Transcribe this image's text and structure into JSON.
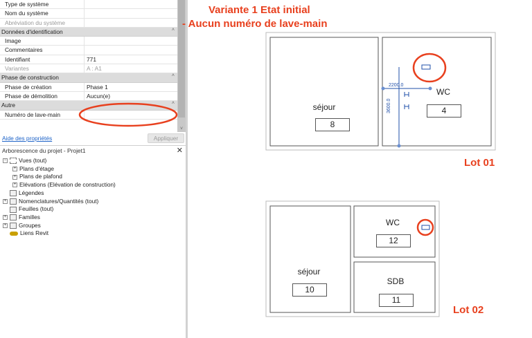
{
  "properties": {
    "rows_top": [
      {
        "key": "Type de système",
        "value": ""
      },
      {
        "key": "Nom du système",
        "value": ""
      },
      {
        "key": "Abréviation du système",
        "value": "",
        "grey": true
      }
    ],
    "groups": [
      {
        "title": "Données d'identification",
        "rows": [
          {
            "key": "Image",
            "value": ""
          },
          {
            "key": "Commentaires",
            "value": ""
          },
          {
            "key": "Identifiant",
            "value": "771"
          },
          {
            "key": "Variantes",
            "value": "A : A1",
            "grey": true
          }
        ]
      },
      {
        "title": "Phase de construction",
        "rows": [
          {
            "key": "Phase de création",
            "value": "Phase 1"
          },
          {
            "key": "Phase de démolition",
            "value": "Aucun(e)"
          }
        ]
      },
      {
        "title": "Autre",
        "rows": [
          {
            "key": "Numéro de lave-main",
            "value": ""
          }
        ]
      }
    ],
    "help_link": "Aide des propriétés",
    "apply_button": "Appliquer"
  },
  "browser": {
    "title": "Arborescence du projet - Projet1",
    "items": [
      {
        "label": "Vues (tout)",
        "icon": "views-icon",
        "expander": "−"
      },
      {
        "label": "Plans d'étage",
        "icon": "",
        "expander": "+"
      },
      {
        "label": "Plans de plafond",
        "icon": "",
        "expander": "+"
      },
      {
        "label": "Elévations (Elévation de construction)",
        "icon": "",
        "expander": "+"
      },
      {
        "label": "Légendes",
        "icon": "legend-icon",
        "expander": ""
      },
      {
        "label": "Nomenclatures/Quantités (tout)",
        "icon": "schedule-icon",
        "expander": "+"
      },
      {
        "label": "Feuilles (tout)",
        "icon": "sheet-icon",
        "expander": ""
      },
      {
        "label": "Familles",
        "icon": "family-icon",
        "expander": "+"
      },
      {
        "label": "Groupes",
        "icon": "group-icon",
        "expander": "+"
      },
      {
        "label": "Liens Revit",
        "icon": "link-icon",
        "expander": ""
      }
    ]
  },
  "drawing": {
    "annotation_line1": "Variante 1 Etat initial",
    "annotation_line2": "- Aucun numéro de lave-main",
    "lot1": {
      "label": "Lot 01",
      "rooms": [
        {
          "name": "séjour",
          "number": "8"
        },
        {
          "name": "WC",
          "number": "4"
        }
      ],
      "dim_horizontal": "2200.0",
      "dim_vertical": "3600.0"
    },
    "lot2": {
      "label": "Lot 02",
      "rooms": [
        {
          "name": "WC",
          "number": "12"
        },
        {
          "name": "séjour",
          "number": "10"
        },
        {
          "name": "SDB",
          "number": "11"
        }
      ]
    },
    "colors": {
      "annotation": "#e8401e",
      "dimension": "#1f4fa8"
    }
  }
}
